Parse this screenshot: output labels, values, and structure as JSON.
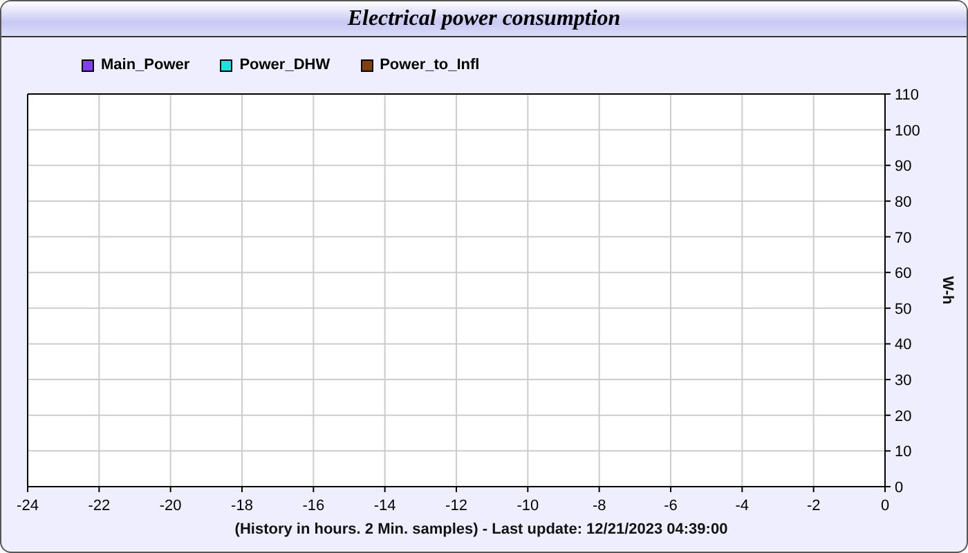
{
  "window": {
    "title": "Electrical power consumption"
  },
  "chart_data": {
    "type": "line",
    "xlabel": "(History in hours. 2 Min. samples) - Last update: 12/21/2023 04:39:00",
    "ylabel": "W-h",
    "grid": true,
    "categories": [
      "-24",
      "-22",
      "-20",
      "-18",
      "-16",
      "-14",
      "-12",
      "-10",
      "-8",
      "-6",
      "-4",
      "-2",
      "0"
    ],
    "series": [
      {
        "name": "Main_Power",
        "color": "#8040f0",
        "values": [
          null,
          null,
          null,
          null,
          null,
          null,
          null,
          null,
          null,
          null,
          null,
          null,
          null
        ]
      },
      {
        "name": "Power_DHW",
        "color": "#20e0e0",
        "values": [
          null,
          null,
          null,
          null,
          null,
          null,
          null,
          null,
          null,
          null,
          null,
          null,
          null
        ]
      },
      {
        "name": "Power_to_Infl",
        "color": "#804010",
        "values": [
          null,
          null,
          null,
          null,
          null,
          null,
          null,
          null,
          null,
          null,
          null,
          null,
          null
        ]
      }
    ],
    "ylim": [
      0,
      110
    ],
    "yticks": [
      0,
      10,
      20,
      30,
      40,
      50,
      60,
      70,
      80,
      90,
      100,
      110
    ]
  }
}
